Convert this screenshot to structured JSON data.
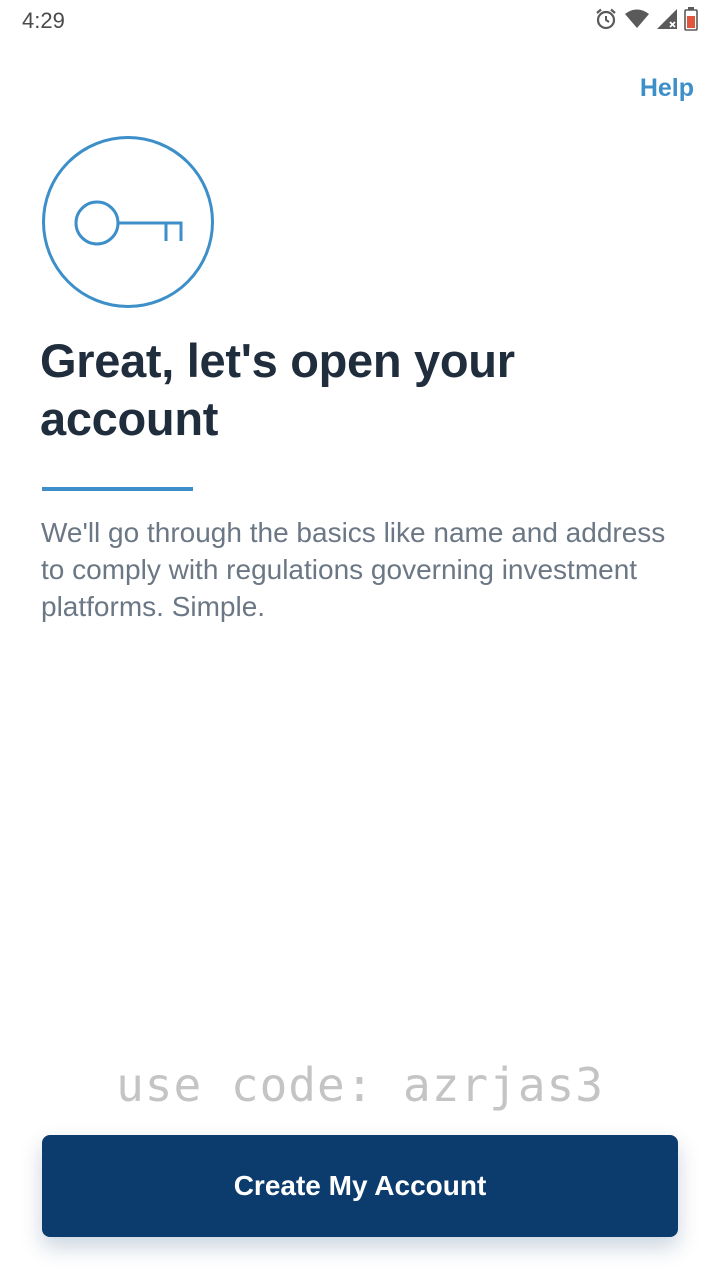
{
  "status_bar": {
    "time": "4:29",
    "icons": [
      "alarm-icon",
      "wifi-icon",
      "signal-icon",
      "battery-icon"
    ]
  },
  "header": {
    "help_label": "Help"
  },
  "main": {
    "icon": "key-icon",
    "title": "Great, let's open your account",
    "description": "We'll go through the basics like name and address to comply with regulations governing investment platforms. Simple.",
    "promo_text": "use code: azrjas3"
  },
  "footer": {
    "button_label": "Create My Account"
  },
  "colors": {
    "accent": "#3d8fc9",
    "primary_button": "#0c3c6e",
    "title_text": "#1f2d3d",
    "body_text": "#6b7785",
    "battery": "#e0553b"
  }
}
